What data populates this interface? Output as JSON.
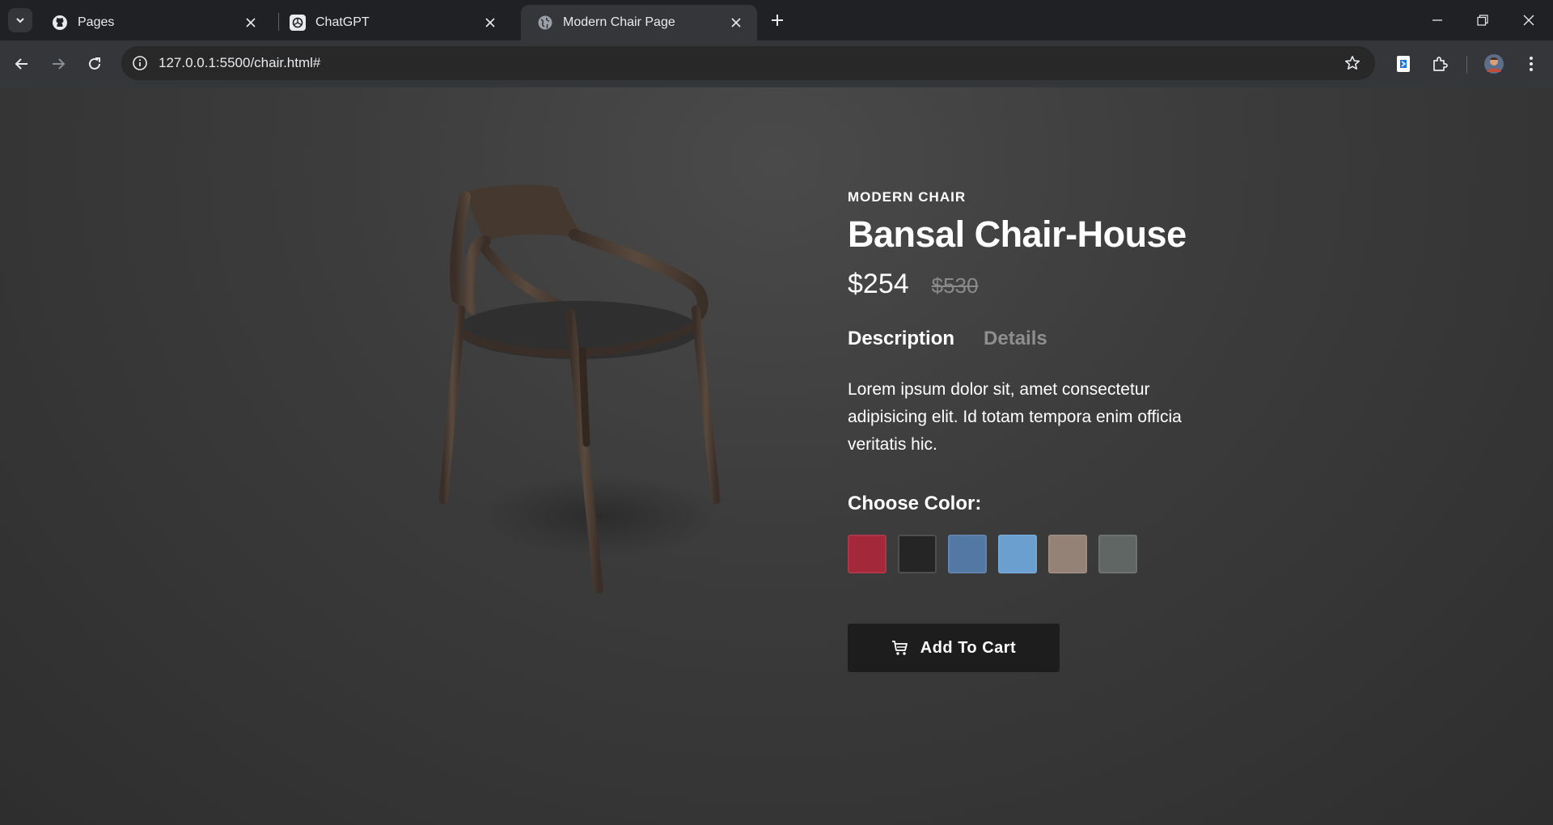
{
  "browser": {
    "tabs": [
      {
        "title": "Pages",
        "icon": "github-icon",
        "active": false
      },
      {
        "title": "ChatGPT",
        "icon": "openai-icon",
        "active": false
      },
      {
        "title": "Modern Chair Page",
        "icon": "globe-icon",
        "active": true
      }
    ],
    "url": "127.0.0.1:5500/chair.html#"
  },
  "product": {
    "eyebrow": "MODERN CHAIR",
    "title": "Bansal Chair-House",
    "price": "$254",
    "old_price": "$530",
    "tabs": [
      "Description",
      "Details"
    ],
    "active_tab": "Description",
    "description": "Lorem ipsum dolor sit, amet consectetur adipisicing elit. Id totam tempora enim officia veritatis hic.",
    "choose_color_label": "Choose Color:",
    "colors": [
      {
        "name": "red",
        "hex": "#a3283a"
      },
      {
        "name": "black",
        "hex": "#252525",
        "selected": true
      },
      {
        "name": "denim-blue",
        "hex": "#5478a4"
      },
      {
        "name": "light-blue",
        "hex": "#6a9fd0"
      },
      {
        "name": "beige",
        "hex": "#958277"
      },
      {
        "name": "grey-green",
        "hex": "#5f6663"
      }
    ],
    "add_to_cart_label": "Add To Cart"
  }
}
